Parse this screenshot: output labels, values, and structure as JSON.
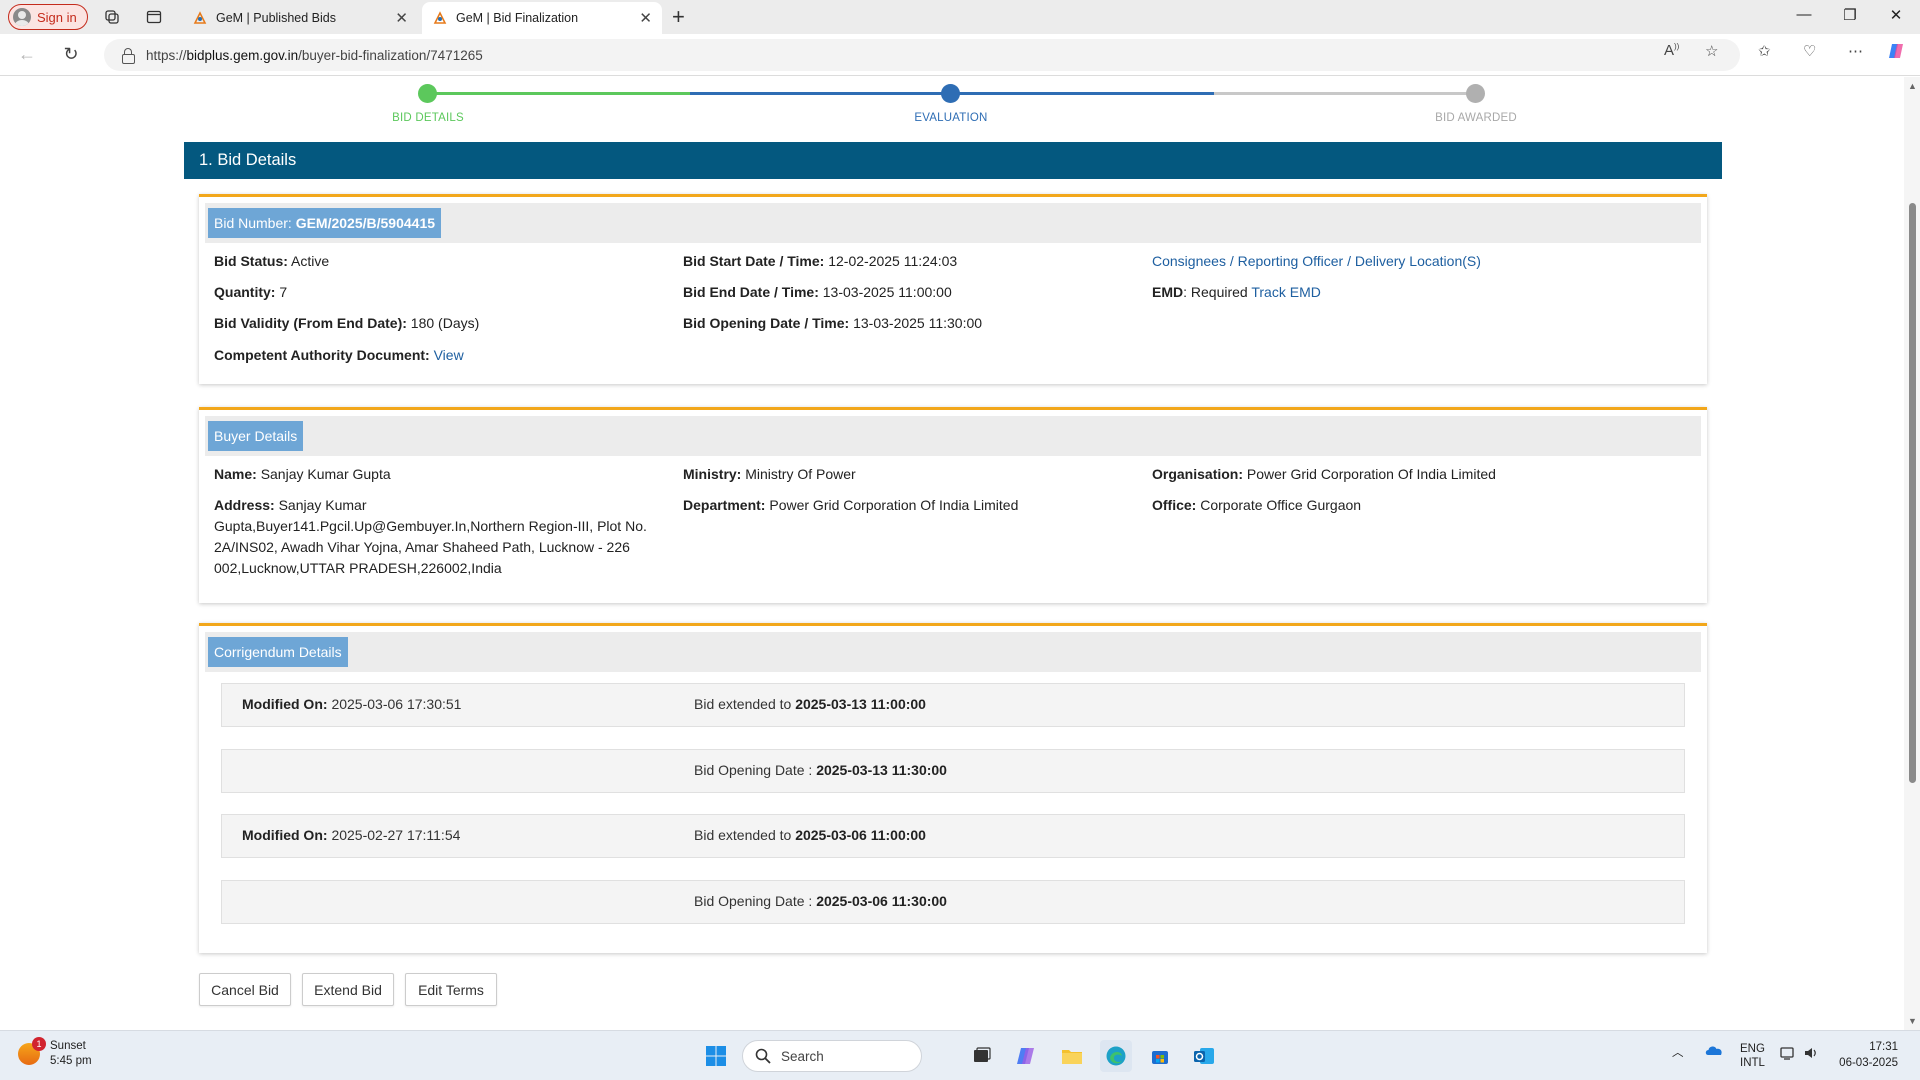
{
  "browser": {
    "signin_label": "Sign in",
    "tabs": [
      {
        "title": "GeM | Published Bids",
        "active": false
      },
      {
        "title": "GeM | Bid Finalization",
        "active": true
      }
    ],
    "url_scheme": "https://",
    "url_host": "bidplus.gem.gov.in",
    "url_path": "/buyer-bid-finalization/7471265"
  },
  "stepper": {
    "steps": [
      {
        "label": "BID DETAILS",
        "state": "done",
        "color": "#5cc85c"
      },
      {
        "label": "EVALUATION",
        "state": "current",
        "color": "#2e6db4"
      },
      {
        "label": "BID AWARDED",
        "state": "pending",
        "color": "#b0b0b0"
      }
    ]
  },
  "section_title": "1. Bid Details",
  "bid": {
    "number_label": "Bid Number:",
    "number": "GEM/2025/B/5904415",
    "status_label": "Bid Status:",
    "status": "Active",
    "quantity_label": "Quantity:",
    "quantity": "7",
    "validity_label": "Bid Validity (From End Date):",
    "validity": "180 (Days)",
    "authority_label": "Competent Authority Document:",
    "authority_link": "View",
    "start_label": "Bid Start Date / Time:",
    "start": "12-02-2025 11:24:03",
    "end_label": "Bid End Date / Time:",
    "end": "13-03-2025 11:00:00",
    "opening_label": "Bid Opening Date / Time:",
    "opening": "13-03-2025 11:30:00",
    "consignees_link": "Consignees / Reporting Officer / Delivery Location(S)",
    "emd_label": "EMD",
    "emd_value": ": Required",
    "emd_link": "Track EMD"
  },
  "buyer": {
    "header": "Buyer Details",
    "name_label": "Name:",
    "name": "Sanjay Kumar Gupta",
    "address_label": "Address:",
    "address": "Sanjay Kumar Gupta,Buyer141.Pgcil.Up@Gembuyer.In,Northern Region-III, Plot No. 2A/INS02, Awadh Vihar Yojna, Amar Shaheed Path, Lucknow - 226 002,Lucknow,UTTAR PRADESH,226002,India",
    "ministry_label": "Ministry:",
    "ministry": "Ministry Of Power",
    "department_label": "Department:",
    "department": "Power Grid Corporation Of India Limited",
    "organisation_label": "Organisation:",
    "organisation": "Power Grid Corporation Of India Limited",
    "office_label": "Office:",
    "office": "Corporate Office Gurgaon"
  },
  "corrigendum": {
    "header": "Corrigendum Details",
    "modified_label": "Modified On:",
    "extended_label": "Bid extended to",
    "opening_label": "Bid Opening Date :",
    "entries": [
      {
        "modified_on": "2025-03-06 17:30:51",
        "extended_to": "2025-03-13 11:00:00",
        "opening_date": "2025-03-13 11:30:00"
      },
      {
        "modified_on": "2025-02-27 17:11:54",
        "extended_to": "2025-03-06 11:00:00",
        "opening_date": "2025-03-06 11:30:00"
      }
    ]
  },
  "actions": {
    "cancel": "Cancel Bid",
    "extend": "Extend Bid",
    "edit": "Edit Terms"
  },
  "taskbar": {
    "weather_title": "Sunset",
    "weather_time": "5:45 pm",
    "weather_badge": "1",
    "search_placeholder": "Search",
    "lang_1": "ENG",
    "lang_2": "INTL",
    "time": "17:31",
    "date": "06-03-2025"
  }
}
